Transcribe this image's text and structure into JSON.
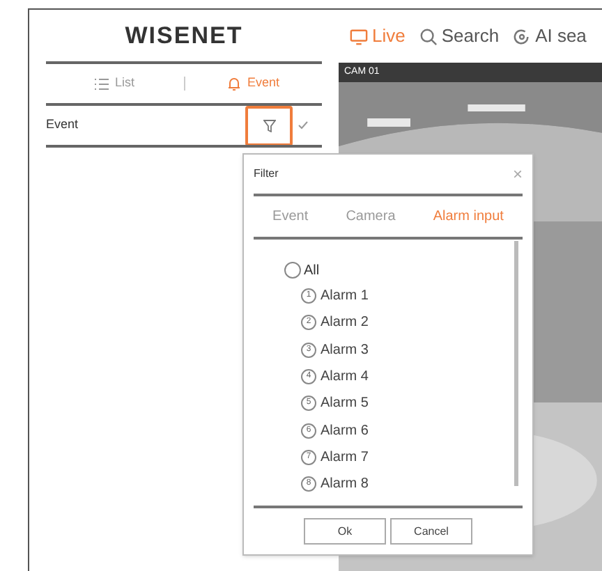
{
  "header": {
    "logo": "WISENET",
    "nav": [
      {
        "label": "Live",
        "selected": true,
        "kind": "live"
      },
      {
        "label": "Search",
        "selected": false,
        "kind": "search"
      },
      {
        "label": "AI sea",
        "selected": false,
        "kind": "ai"
      }
    ]
  },
  "sidebar": {
    "tabs": [
      {
        "label": "List",
        "selected": false,
        "kind": "list"
      },
      {
        "label": "Event",
        "selected": true,
        "kind": "event"
      }
    ],
    "row": {
      "label": "Event",
      "filter_highlighted": true
    }
  },
  "camera": {
    "label": "CAM 01"
  },
  "dialog": {
    "title": "Filter",
    "close": "×",
    "tabs": [
      {
        "label": "Event",
        "selected": false
      },
      {
        "label": "Camera",
        "selected": false
      },
      {
        "label": "Alarm input",
        "selected": true
      }
    ],
    "all": {
      "label": "All",
      "checked": false
    },
    "alarms": [
      {
        "number": "1",
        "label": "Alarm 1"
      },
      {
        "number": "2",
        "label": "Alarm 2"
      },
      {
        "number": "3",
        "label": "Alarm 3"
      },
      {
        "number": "4",
        "label": "Alarm 4"
      },
      {
        "number": "5",
        "label": "Alarm 5"
      },
      {
        "number": "6",
        "label": "Alarm 6"
      },
      {
        "number": "7",
        "label": "Alarm 7"
      },
      {
        "number": "8",
        "label": "Alarm 8"
      }
    ],
    "buttons": [
      "Ok",
      "Cancel"
    ]
  }
}
